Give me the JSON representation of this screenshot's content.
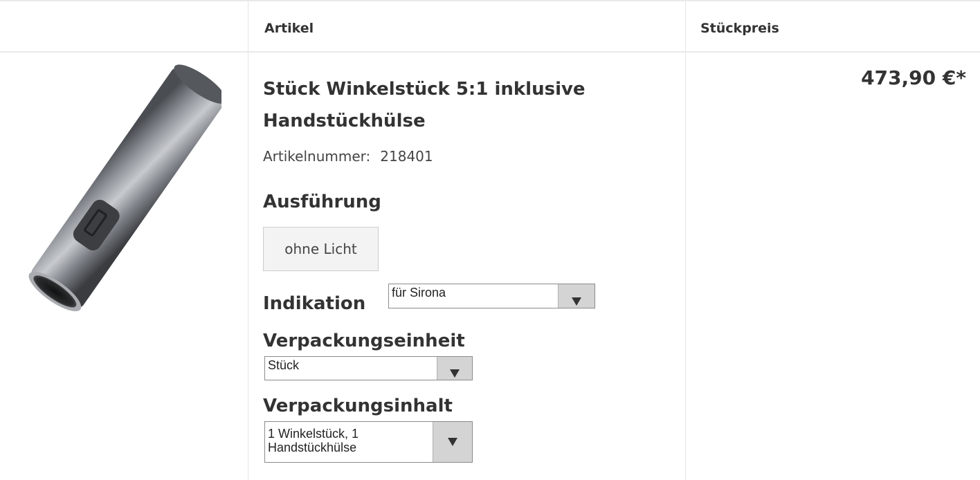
{
  "table": {
    "header_article": "Artikel",
    "header_unit_price": "Stückpreis"
  },
  "product": {
    "title": "Stück Winkelstück 5:1 inklusive Handstückhülse",
    "article_number_label": "Artikelnummer:",
    "article_number": "218401",
    "image_icon": "handpiece-sleeve-image",
    "price": "473,90 €*"
  },
  "variants": {
    "ausfuehrung_label": "Ausführung",
    "ausfuehrung_option": "ohne Licht",
    "indikation_label": "Indikation",
    "indikation_selected": "für Sirona",
    "verpackungseinheit_label": "Verpackungseinheit",
    "verpackungseinheit_selected": "Stück",
    "verpackungsinhalt_label": "Verpackungsinhalt",
    "verpackungsinhalt_selected_line1": "1 Winkelstück, 1",
    "verpackungsinhalt_selected_line2": "Handstückhülse"
  },
  "colors": {
    "text": "#333333",
    "border": "#e5e5e5",
    "button_bg": "#f3f3f3",
    "select_arrow_bg": "#d4d4d4"
  }
}
